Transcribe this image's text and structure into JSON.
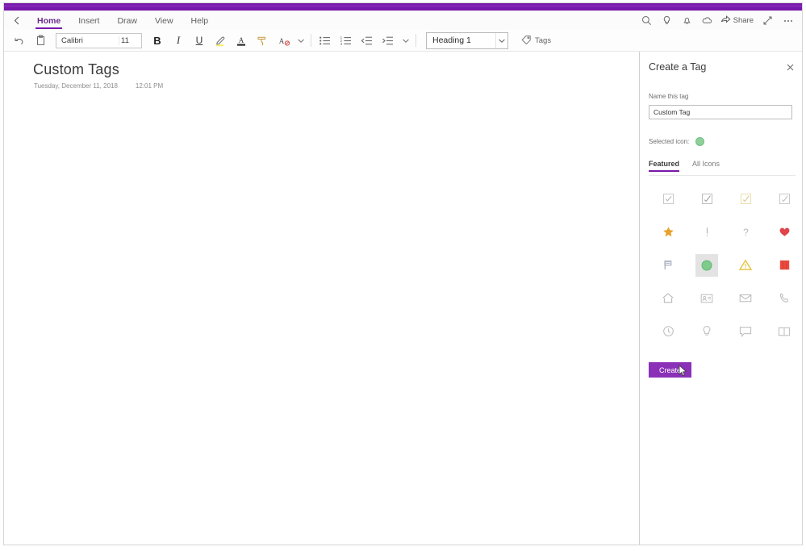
{
  "window": {
    "accent_color": "#7719aa",
    "titlebar_color": "#7719aa"
  },
  "ribbon": {
    "back_icon": "chevron-left-icon",
    "tabs": [
      {
        "label": "Home",
        "active": true
      },
      {
        "label": "Insert",
        "active": false
      },
      {
        "label": "Draw",
        "active": false
      },
      {
        "label": "View",
        "active": false
      },
      {
        "label": "Help",
        "active": false
      }
    ],
    "right_actions": [
      {
        "name": "search-icon",
        "label": ""
      },
      {
        "name": "lightbulb-icon",
        "label": ""
      },
      {
        "name": "bell-icon",
        "label": ""
      },
      {
        "name": "cloud-icon",
        "label": ""
      }
    ],
    "share_label": "Share",
    "expand_icon": "expand-icon",
    "more_icon": "more-ellipsis-icon"
  },
  "toolbar": {
    "undo_icon": "undo-icon",
    "paste_icon": "clipboard-paste-icon",
    "font_name": "Calibri",
    "font_size": "11",
    "bold_label": "B",
    "italic_label": "I",
    "underline_label": "U",
    "highlight_icon": "highlighter-icon",
    "font_color_icon": "font-color-icon",
    "format_painter_icon": "format-painter-icon",
    "clear_format_icon": "clear-formatting-icon",
    "font_more_icon": "chevron-down-icon",
    "bullets_icon": "bulleted-list-icon",
    "numbering_icon": "numbered-list-icon",
    "decrease_indent_icon": "decrease-indent-icon",
    "increase_indent_icon": "increase-indent-icon",
    "paragraph_more_icon": "chevron-down-icon",
    "style_value": "Heading 1",
    "style_dropdown_icon": "chevron-down-icon",
    "tags_label": "Tags",
    "tags_icon": "tag-icon"
  },
  "note": {
    "title": "Custom Tags",
    "date": "Tuesday, December 11, 2018",
    "time": "12:01 PM"
  },
  "pane": {
    "title": "Create a Tag",
    "close_icon": "close-icon",
    "name_label": "Name this tag",
    "name_value": "Custom Tag",
    "name_placeholder": "Name this tag",
    "selected_icon_label": "Selected icon:",
    "selected_icon_color": "#8ed19a",
    "tabs": [
      {
        "label": "Featured",
        "active": true
      },
      {
        "label": "All Icons",
        "active": false
      }
    ],
    "icons": [
      {
        "name": "checkbox-todo-icon",
        "selected": false
      },
      {
        "name": "checkbox-checked-icon",
        "selected": false
      },
      {
        "name": "checkbox-yellow-icon",
        "selected": false
      },
      {
        "name": "checkbox-outline-icon",
        "selected": false
      },
      {
        "name": "star-icon",
        "selected": false
      },
      {
        "name": "exclamation-icon",
        "selected": false
      },
      {
        "name": "question-mark-icon",
        "selected": false
      },
      {
        "name": "heart-icon",
        "selected": false
      },
      {
        "name": "flag-icon",
        "selected": false
      },
      {
        "name": "green-circle-icon",
        "selected": true
      },
      {
        "name": "warning-triangle-icon",
        "selected": false
      },
      {
        "name": "red-square-icon",
        "selected": false
      },
      {
        "name": "home-icon",
        "selected": false
      },
      {
        "name": "contact-card-icon",
        "selected": false
      },
      {
        "name": "envelope-icon",
        "selected": false
      },
      {
        "name": "phone-icon",
        "selected": false
      },
      {
        "name": "clock-icon",
        "selected": false
      },
      {
        "name": "lightbulb-icon",
        "selected": false
      },
      {
        "name": "comment-bubble-icon",
        "selected": false
      },
      {
        "name": "book-icon",
        "selected": false
      }
    ],
    "create_label": "Create",
    "create_button_color": "#8a31b8"
  }
}
